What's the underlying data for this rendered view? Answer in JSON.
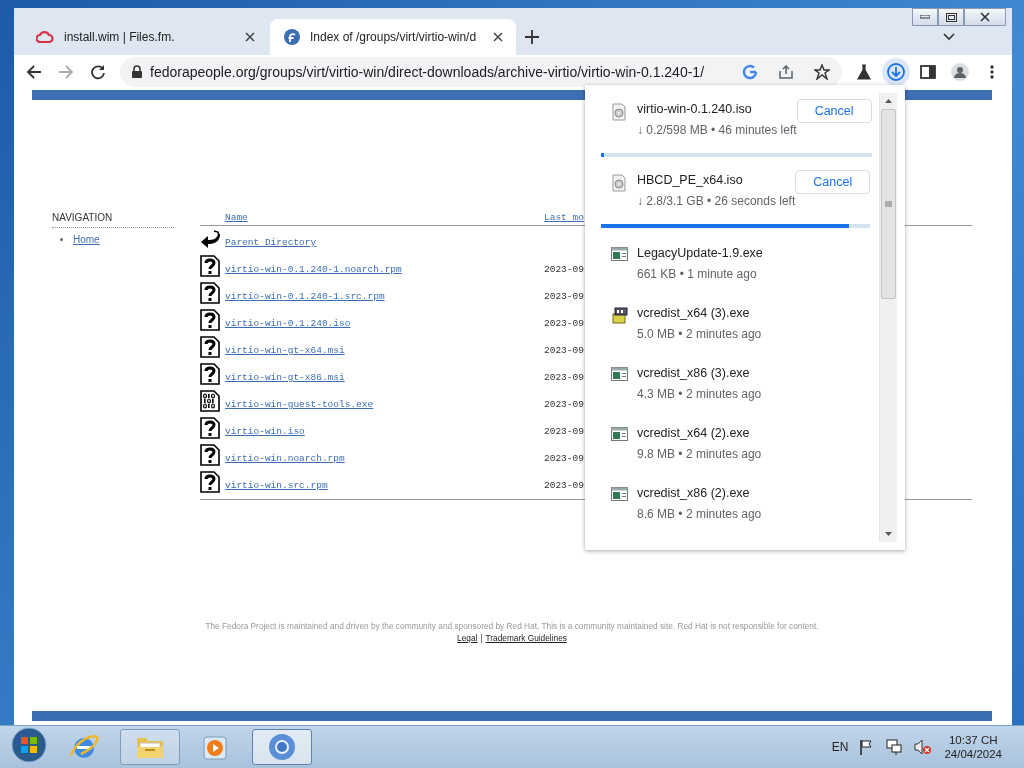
{
  "browser": {
    "tabs": [
      {
        "title": "install.wim | Files.fm.",
        "selected": false
      },
      {
        "title": "Index of /groups/virt/virtio-win/d",
        "selected": true
      }
    ],
    "address": "fedorapeople.org/groups/virt/virtio-win/direct-downloads/archive-virtio/virtio-win-0.1.240-1/"
  },
  "page": {
    "navigation": {
      "title": "NAVIGATION",
      "items": [
        "Home"
      ]
    },
    "listing": {
      "columns": [
        "Name",
        "Last mo"
      ],
      "rows": [
        {
          "kind": "parent",
          "name": "Parent Directory",
          "date": ""
        },
        {
          "kind": "unknown",
          "name": "virtio-win-0.1.240-1.noarch.rpm",
          "date": "2023-09"
        },
        {
          "kind": "unknown",
          "name": "virtio-win-0.1.240-1.src.rpm",
          "date": "2023-09"
        },
        {
          "kind": "unknown",
          "name": "virtio-win-0.1.240.iso",
          "date": "2023-09"
        },
        {
          "kind": "unknown",
          "name": "virtio-win-gt-x64.msi",
          "date": "2023-09"
        },
        {
          "kind": "unknown",
          "name": "virtio-win-gt-x86.msi",
          "date": "2023-09"
        },
        {
          "kind": "binary",
          "name": "virtio-win-guest-tools.exe",
          "date": "2023-09"
        },
        {
          "kind": "unknown",
          "name": "virtio-win.iso",
          "date": "2023-09"
        },
        {
          "kind": "unknown",
          "name": "virtio-win.noarch.rpm",
          "date": "2023-09"
        },
        {
          "kind": "unknown",
          "name": "virtio-win.src.rpm",
          "date": "2023-09"
        }
      ]
    },
    "footer": {
      "text": "The Fedora Project is maintained and driven by the community and sponsored by Red Hat. This is a community maintained site. Red Hat is not responsible for content.",
      "links": [
        "Legal",
        "Trademark Guidelines"
      ],
      "separator": "|"
    }
  },
  "downloads": {
    "items": [
      {
        "kind": "progress",
        "name": "virtio-win-0.1.240.iso",
        "status": "↓ 0.2/598 MB • 46 minutes left",
        "action": "Cancel",
        "level": 0.01
      },
      {
        "kind": "progress",
        "name": "HBCD_PE_x64.iso",
        "status": "↓ 2.8/3.1 GB • 26 seconds left",
        "action": "Cancel",
        "level": 0.92
      },
      {
        "kind": "program",
        "name": "LegacyUpdate-1.9.exe",
        "status": "661 KB • 1 minute ago"
      },
      {
        "kind": "installer",
        "name": "vcredist_x64 (3).exe",
        "status": "5.0 MB • 2 minutes ago"
      },
      {
        "kind": "program",
        "name": "vcredist_x86 (3).exe",
        "status": "4.3 MB • 2 minutes ago"
      },
      {
        "kind": "program",
        "name": "vcredist_x64 (2).exe",
        "status": "9.8 MB • 2 minutes ago"
      },
      {
        "kind": "program",
        "name": "vcredist_x86 (2).exe",
        "status": "8.6 MB • 2 minutes ago"
      }
    ]
  },
  "taskbar": {
    "apps": [
      {
        "kind": "ie",
        "running": false,
        "selected": false
      },
      {
        "kind": "explorer",
        "running": true,
        "selected": false
      },
      {
        "kind": "media",
        "running": false,
        "selected": false
      },
      {
        "kind": "chrome",
        "running": true,
        "selected": true
      }
    ],
    "language": "EN",
    "time": "10:37 CH",
    "date": "24/04/2024"
  }
}
